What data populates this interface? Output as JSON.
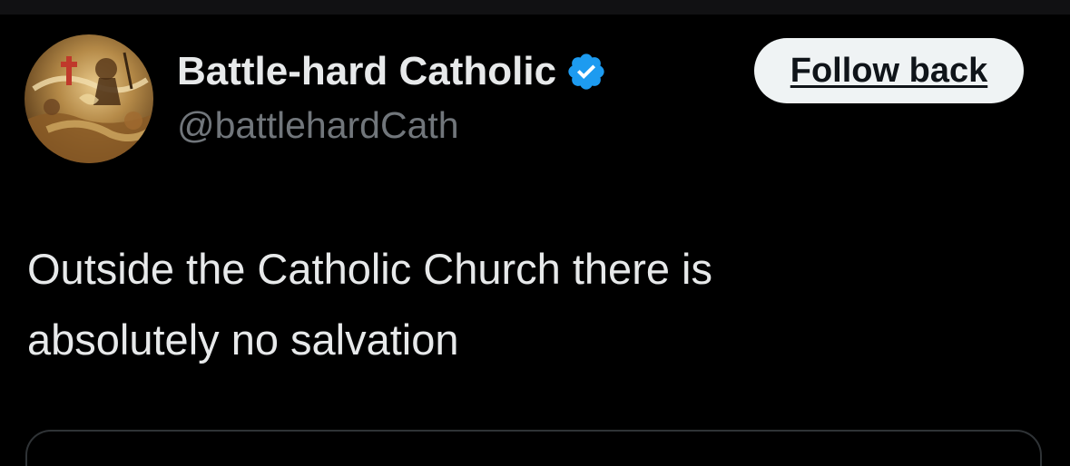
{
  "author": {
    "display_name": "Battle-hard Catholic",
    "handle": "@battlehardCath",
    "verified": true,
    "avatar_icon": "painting-avatar"
  },
  "actions": {
    "follow_label": "Follow back"
  },
  "tweet": {
    "line1": "Outside the Catholic Church there is",
    "line2": "absolutely no salvation"
  },
  "colors": {
    "background": "#000000",
    "text_primary": "#e7e9ea",
    "text_secondary": "#71767b",
    "verified_blue": "#1d9bf0",
    "button_bg": "#eff3f4"
  }
}
